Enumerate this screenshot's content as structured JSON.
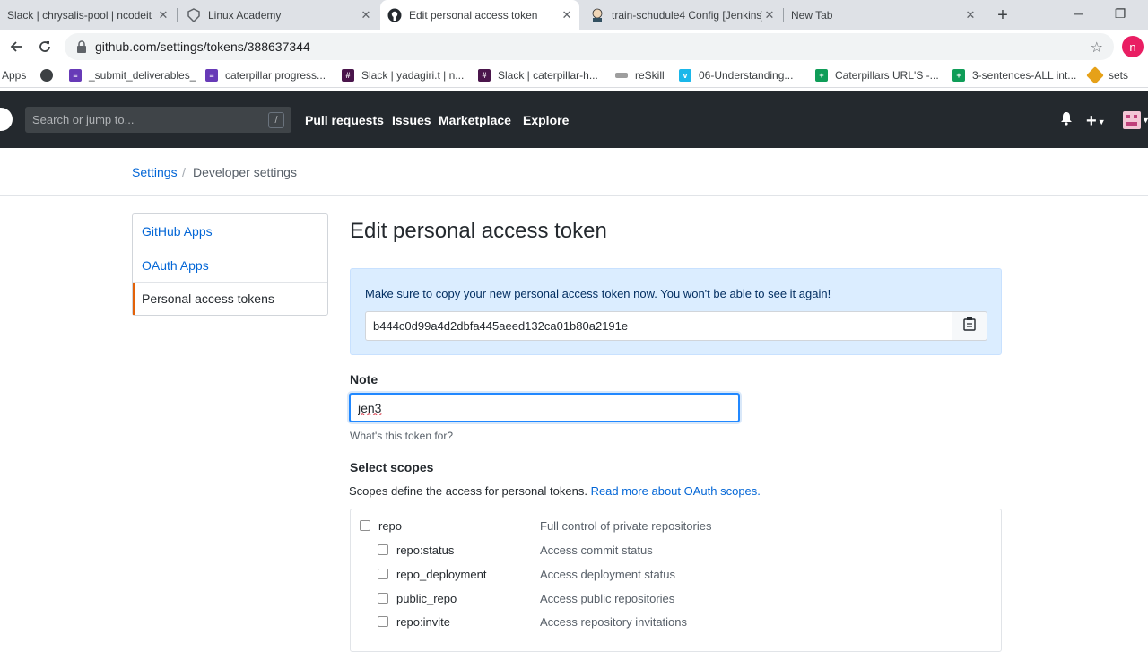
{
  "browser": {
    "tabs": [
      {
        "title": "Slack | chrysalis-pool | ncodeit",
        "icon": "slack-icon"
      },
      {
        "title": "Linux Academy",
        "icon": "linux-academy-icon"
      },
      {
        "title": "Edit personal access token",
        "icon": "github-icon",
        "active": true
      },
      {
        "title": "train-schudule4 Config [Jenkins]",
        "icon": "jenkins-icon"
      },
      {
        "title": "New Tab",
        "icon": ""
      }
    ],
    "new_tab_label": "+",
    "url": "github.com/settings/tokens/388637344",
    "profile_initial": "n",
    "bookmarks": [
      {
        "label": "Apps",
        "icon": "apps-icon"
      },
      {
        "label": "",
        "icon": "globe-icon"
      },
      {
        "label": "_submit_deliverables_",
        "icon": "forms-icon"
      },
      {
        "label": "caterpillar progress...",
        "icon": "forms-icon"
      },
      {
        "label": "Slack | yadagiri.t | n...",
        "icon": "slack-icon"
      },
      {
        "label": "Slack | caterpillar-h...",
        "icon": "slack-icon"
      },
      {
        "label": "reSkill",
        "icon": "reskill-icon"
      },
      {
        "label": "06-Understanding...",
        "icon": "vimeo-icon"
      },
      {
        "label": "Caterpillars URL'S -...",
        "icon": "sheets-icon"
      },
      {
        "label": "3-sentences-ALL int...",
        "icon": "sheets-icon"
      },
      {
        "label": "sets",
        "icon": "sets-icon"
      }
    ]
  },
  "header": {
    "search_placeholder": "Search or jump to...",
    "search_key": "/",
    "nav": [
      "Pull requests",
      "Issues",
      "Marketplace",
      "Explore"
    ]
  },
  "breadcrumb": {
    "parent": "Settings",
    "separator": "/",
    "current": "Developer settings"
  },
  "sidemenu": [
    "GitHub Apps",
    "OAuth Apps",
    "Personal access tokens"
  ],
  "main": {
    "title": "Edit personal access token",
    "flash_message": "Make sure to copy your new personal access token now. You won't be able to see it again!",
    "token": "b444c0d99a4d2dbfa445aeed132ca01b80a2191e",
    "note_label": "Note",
    "note_value": "jen3",
    "note_hint": "What's this token for?",
    "scopes_label": "Select scopes",
    "scopes_desc": "Scopes define the access for personal tokens.",
    "scopes_link": "Read more about OAuth scopes."
  },
  "scopes": [
    {
      "name": "repo",
      "desc": "Full control of private repositories"
    },
    {
      "name": "repo:status",
      "desc": "Access commit status"
    },
    {
      "name": "repo_deployment",
      "desc": "Access deployment status"
    },
    {
      "name": "public_repo",
      "desc": "Access public repositories"
    },
    {
      "name": "repo:invite",
      "desc": "Access repository invitations"
    }
  ],
  "colors": {
    "github_header": "#24292e",
    "link": "#0366d6",
    "flash_bg": "#dbedff",
    "focus": "#2188ff",
    "selected_marker": "#e36209"
  }
}
